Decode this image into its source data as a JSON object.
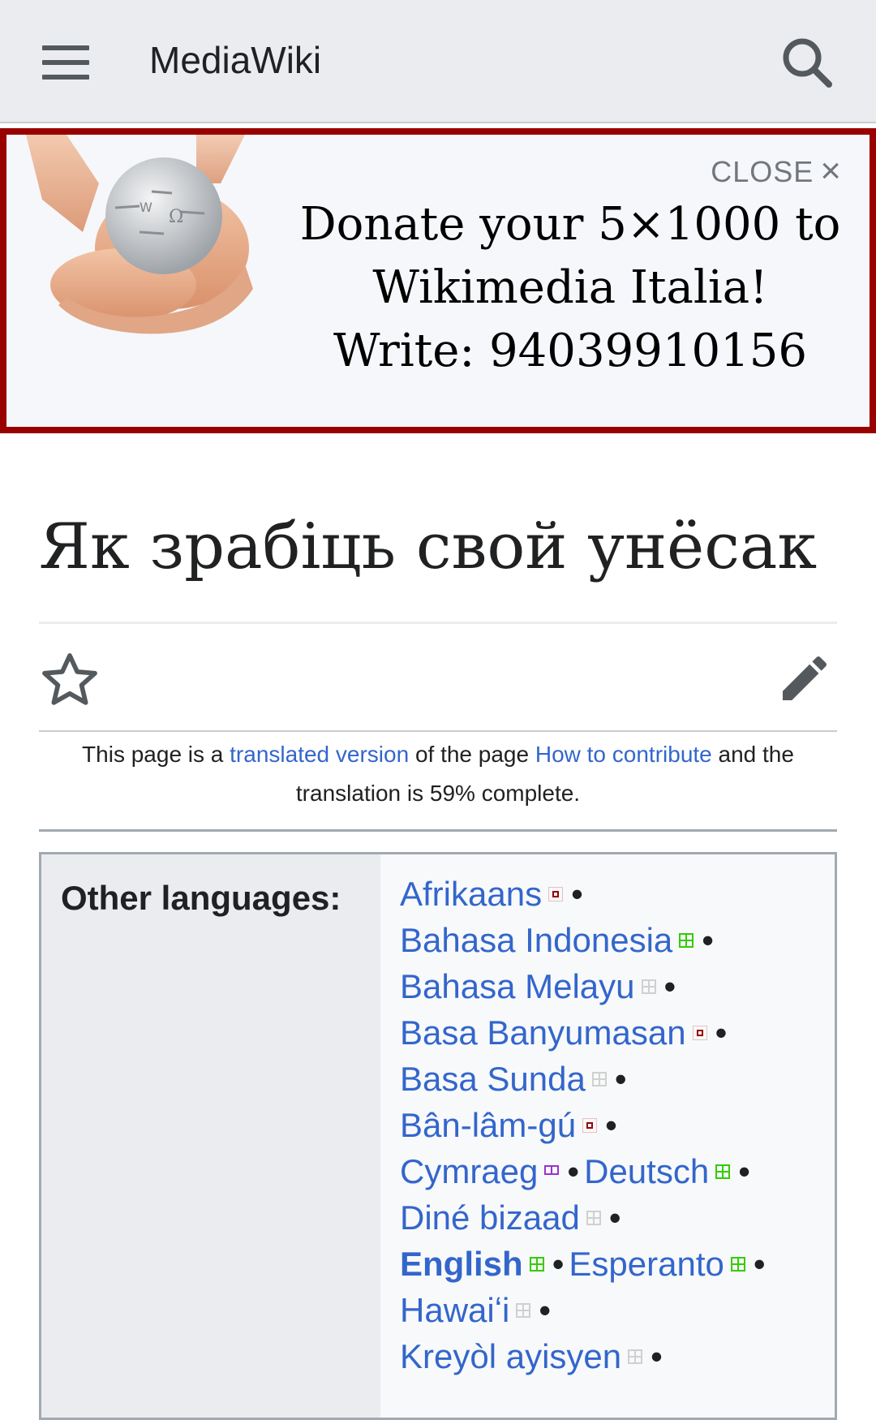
{
  "header": {
    "site_title": "MediaWiki",
    "menu_icon": "hamburger-menu-icon",
    "search_icon": "search-icon"
  },
  "banner": {
    "close_label": "CLOSE",
    "line1": "Donate your 5×1000 to",
    "line2": "Wikimedia Italia!",
    "line3": "Write: 94039910156",
    "border_color": "#990000"
  },
  "page": {
    "title": "Як зрабіць свой унёсак",
    "note_prefix": "This page is a ",
    "note_link1": "translated version",
    "note_mid": " of the page ",
    "note_link2": "How to contribute",
    "note_suffix1": " and the",
    "note_line2": "translation is 59% complete."
  },
  "languages": {
    "label": "Other languages:",
    "items": [
      {
        "name": "Afrikaans",
        "status": "red"
      },
      {
        "name": "Bahasa Indonesia",
        "status": "green"
      },
      {
        "name": "Bahasa Melayu",
        "status": "gray"
      },
      {
        "name": "Basa Banyumasan",
        "status": "red"
      },
      {
        "name": "Basa Sunda",
        "status": "gray"
      },
      {
        "name": "Bân-lâm-gú",
        "status": "red"
      },
      {
        "name": "Cymraeg",
        "status": "purple"
      },
      {
        "name": "Deutsch",
        "status": "green"
      },
      {
        "name": "Diné bizaad",
        "status": "gray"
      },
      {
        "name": "English",
        "status": "green"
      },
      {
        "name": "Esperanto",
        "status": "green"
      },
      {
        "name": "Hawaiʻi",
        "status": "gray"
      },
      {
        "name": "Kreyòl ayisyen",
        "status": "gray"
      }
    ],
    "separator": "•"
  },
  "colors": {
    "link": "#3366cc",
    "header_bg": "#eaecf0"
  }
}
